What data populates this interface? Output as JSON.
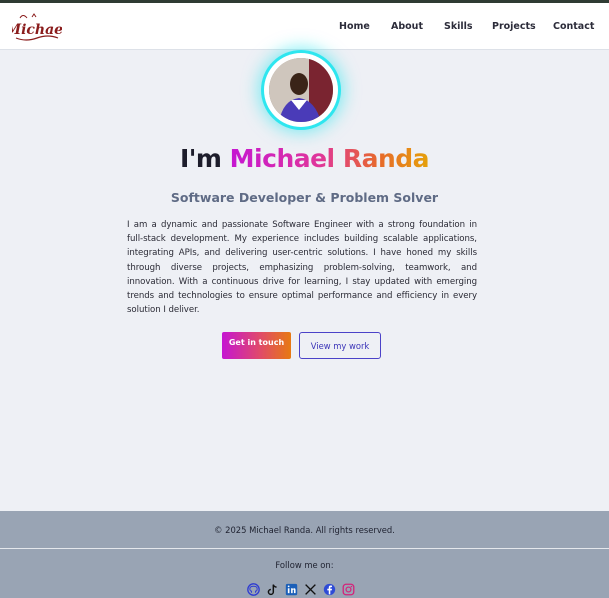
{
  "header": {
    "logo_text": "Michael",
    "nav": [
      "Home",
      "About",
      "Skills",
      "Projects",
      "Contact"
    ]
  },
  "hero": {
    "greeting": "I'm ",
    "name": "Michael Randa",
    "subtitle": "Software Developer & Problem Solver",
    "bio": "I am a dynamic and passionate Software Engineer with a strong foundation in full-stack development. My experience includes building scalable applications, integrating APIs, and delivering user-centric solutions. I have honed my skills through diverse projects, emphasizing problem-solving, teamwork, and innovation. With a continuous drive for learning, I stay updated with emerging trends and technologies to ensure optimal performance and efficiency in every solution I deliver.",
    "primary_button": "Get in touch",
    "secondary_button": "View my work"
  },
  "footer": {
    "copyright": "© 2025 Michael Randa. All rights reserved.",
    "follow_label": "Follow me on:",
    "socials": [
      "github-icon",
      "tiktok-icon",
      "linkedin-icon",
      "x-icon",
      "facebook-icon",
      "instagram-icon"
    ]
  },
  "colors": {
    "accent_gradient_start": "#c516d2",
    "accent_gradient_end": "#e5a10a",
    "secondary_button": "#4b42c8",
    "avatar_glow": "#2ee6ef",
    "footer_bg": "#99a4b4"
  }
}
